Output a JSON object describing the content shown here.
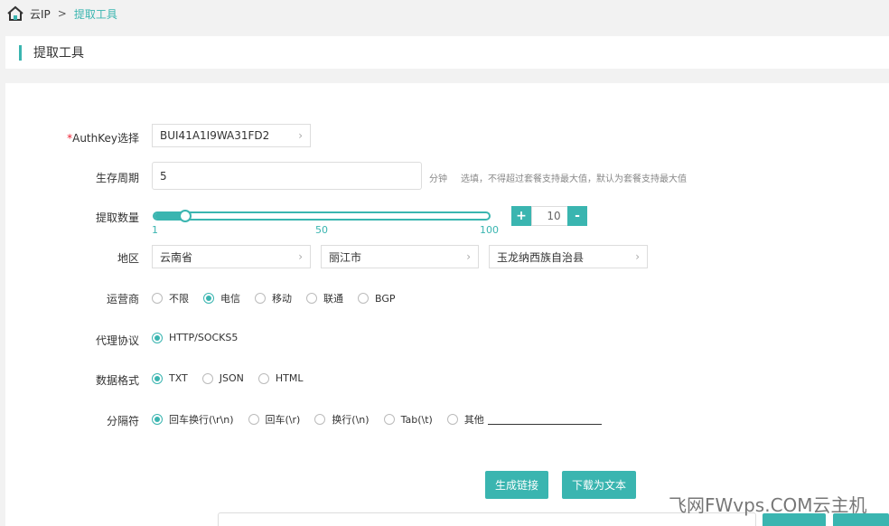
{
  "breadcrumb": {
    "root": "云IP",
    "separator": ">",
    "current": "提取工具"
  },
  "page": {
    "title": "提取工具"
  },
  "form": {
    "authkey": {
      "required_mark": "*",
      "label": "AuthKey选择",
      "value": "BUI41A1I9WA31FD2"
    },
    "lifetime": {
      "label": "生存周期",
      "value": "5",
      "unit": "分钟",
      "hint": "选填，不得超过套餐支持最大值，默认为套餐支持最大值"
    },
    "quantity": {
      "label": "提取数量",
      "min": 1,
      "max": 100,
      "value": 10,
      "ticks": [
        "1",
        "50",
        "100"
      ],
      "plus": "+",
      "minus": "-",
      "display": "10"
    },
    "region": {
      "label": "地区",
      "province": "云南省",
      "city": "丽江市",
      "county": "玉龙纳西族自治县"
    },
    "isp": {
      "label": "运营商",
      "options": [
        "不限",
        "电信",
        "移动",
        "联通",
        "BGP"
      ],
      "selected": 1
    },
    "protocol": {
      "label": "代理协议",
      "options": [
        "HTTP/SOCKS5"
      ],
      "selected": 0
    },
    "format": {
      "label": "数据格式",
      "options": [
        "TXT",
        "JSON",
        "HTML"
      ],
      "selected": 0
    },
    "separator": {
      "label": "分隔符",
      "options": [
        "回车换行(\\r\\n)",
        "回车(\\r)",
        "换行(\\n)",
        "Tab(\\t)",
        "其他"
      ],
      "selected": 0
    }
  },
  "actions": {
    "generate": "生成链接",
    "download": "下载为文本"
  },
  "watermark": "飞网FWvps.COM云主机",
  "colors": {
    "accent": "#3ab5b0",
    "required": "#e22233"
  }
}
